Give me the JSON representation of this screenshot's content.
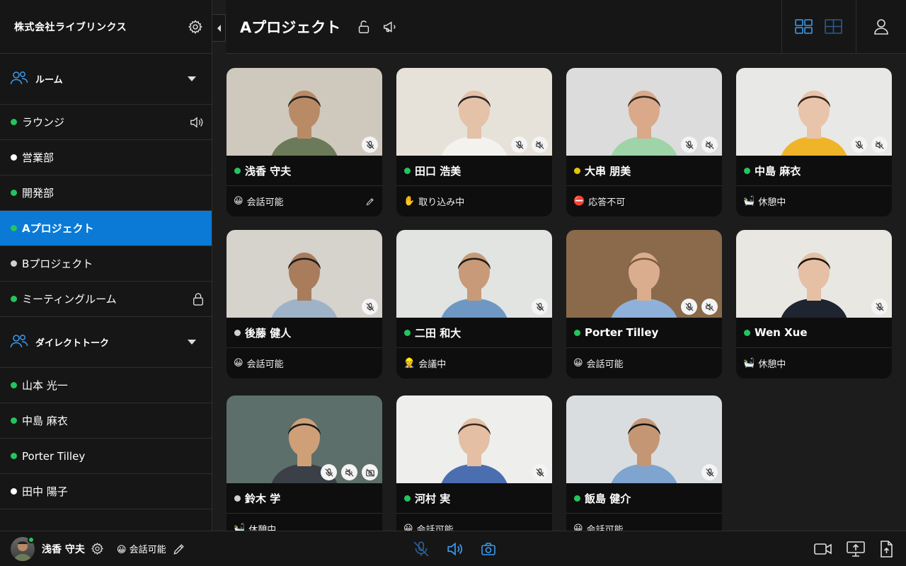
{
  "sidebar": {
    "company": "株式会社ライブリンクス",
    "rooms_label": "ルーム",
    "rooms": [
      {
        "name": "ラウンジ",
        "status_color": "#22c55e",
        "icon": "speaker-icon"
      },
      {
        "name": "営業部",
        "status_color": "#ffffff",
        "icon": ""
      },
      {
        "name": "開発部",
        "status_color": "#22c55e",
        "icon": ""
      },
      {
        "name": "Aプロジェクト",
        "status_color": "#22c55e",
        "icon": "",
        "active": true
      },
      {
        "name": "Bプロジェクト",
        "status_color": "#d0d0d0",
        "icon": ""
      },
      {
        "name": "ミーティングルーム",
        "status_color": "#22c55e",
        "icon": "lock-icon"
      }
    ],
    "direct_label": "ダイレクトトーク",
    "direct": [
      {
        "name": "山本 光一",
        "status_color": "#22c55e"
      },
      {
        "name": "中島 麻衣",
        "status_color": "#22c55e"
      },
      {
        "name": "Porter Tilley",
        "status_color": "#22c55e"
      },
      {
        "name": "田中 陽子",
        "status_color": "#ffffff"
      }
    ]
  },
  "header": {
    "room_title": "Aプロジェクト"
  },
  "participants": [
    {
      "name": "浅香 守夫",
      "status_color": "#22c55e",
      "emoji": "😀",
      "status": "会話可能",
      "editable": true,
      "badges": [
        "mic-off-icon"
      ],
      "bg": "#cfc8bd",
      "skin": "#b98a66",
      "hair": "#222",
      "shirt": "#6b7a58"
    },
    {
      "name": "田口 浩美",
      "status_color": "#22c55e",
      "emoji": "✋",
      "status": "取り込み中",
      "badges": [
        "mic-off-icon",
        "speaker-off-icon"
      ],
      "bg": "#e6e2da",
      "skin": "#e3c2a8",
      "hair": "#2a2422",
      "shirt": "#f4f2ee"
    },
    {
      "name": "大串 朋美",
      "status_color": "#e5c700",
      "emoji": "⛔",
      "status": "応答不可",
      "badges": [
        "mic-off-icon",
        "speaker-off-icon"
      ],
      "bg": "#dcdcdc",
      "skin": "#d9a98a",
      "hair": "#3a2a20",
      "shirt": "#9ed4a8"
    },
    {
      "name": "中島 麻衣",
      "status_color": "#22c55e",
      "emoji": "🛀",
      "status": "休憩中",
      "badges": [
        "mic-off-icon",
        "speaker-off-icon"
      ],
      "bg": "#e8e8e6",
      "skin": "#e8c4aa",
      "hair": "#3a2418",
      "shirt": "#f0b429"
    },
    {
      "name": "後藤 健人",
      "status_color": "#d0d0d0",
      "emoji": "😀",
      "status": "会話可能",
      "badges": [
        "mic-off-icon"
      ],
      "bg": "#d6d2cc",
      "skin": "#a97c5c",
      "hair": "#1b1b1b",
      "shirt": "#9fb3c8"
    },
    {
      "name": "二田 和大",
      "status_color": "#22c55e",
      "emoji": "👷",
      "status": "会議中",
      "badges": [
        "mic-off-icon"
      ],
      "bg": "#e2e4e2",
      "skin": "#c89a78",
      "hair": "#1a1a1a",
      "shirt": "#6e97c4"
    },
    {
      "name": "Porter Tilley",
      "status_color": "#22c55e",
      "emoji": "😀",
      "status": "会話可能",
      "badges": [
        "mic-off-icon",
        "speaker-off-icon"
      ],
      "bg": "#8a6a4a",
      "skin": "#d9ad8e",
      "hair": "#7a5a3a",
      "shirt": "#8fb0d8"
    },
    {
      "name": "Wen Xue",
      "status_color": "#22c55e",
      "emoji": "🛀",
      "status": "休憩中",
      "badges": [
        "mic-off-icon"
      ],
      "bg": "#e9e7e2",
      "skin": "#e5c0a4",
      "hair": "#1c1410",
      "shirt": "#1e2430"
    },
    {
      "name": "鈴木 学",
      "status_color": "#d0d0d0",
      "emoji": "🛀",
      "status": "休憩中",
      "badges": [
        "mic-off-icon",
        "speaker-off-icon",
        "camera-off-icon"
      ],
      "bg": "#5d6f6a",
      "skin": "#cfa078",
      "hair": "#1a1a1a",
      "shirt": "#3a3f48"
    },
    {
      "name": "河村 実",
      "status_color": "#22c55e",
      "emoji": "😀",
      "status": "会話可能",
      "badges": [
        "mic-off-icon"
      ],
      "bg": "#eeeeec",
      "skin": "#e4bfa3",
      "hair": "#3a2a22",
      "shirt": "#4a6eb0"
    },
    {
      "name": "飯島 健介",
      "status_color": "#22c55e",
      "emoji": "😀",
      "status": "会話可能",
      "badges": [
        "mic-off-icon"
      ],
      "bg": "#d9dde0",
      "skin": "#c59673",
      "hair": "#151515",
      "shirt": "#7ea4cf"
    }
  ],
  "me": {
    "name": "浅香 守夫",
    "emoji": "😀",
    "status": "会話可能",
    "status_color": "#22c55e"
  },
  "accent": "#0a7ad6"
}
